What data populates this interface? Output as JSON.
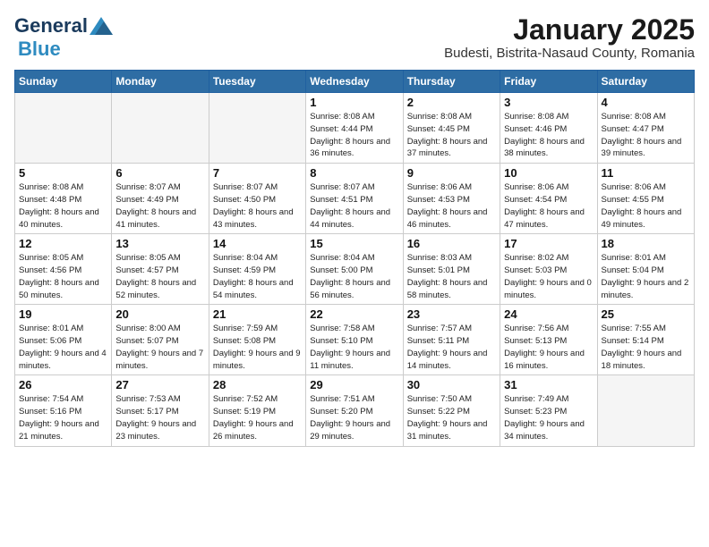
{
  "header": {
    "logo_general": "General",
    "logo_blue": "Blue",
    "month_year": "January 2025",
    "location": "Budesti, Bistrita-Nasaud County, Romania"
  },
  "weekdays": [
    "Sunday",
    "Monday",
    "Tuesday",
    "Wednesday",
    "Thursday",
    "Friday",
    "Saturday"
  ],
  "weeks": [
    [
      {
        "day": "",
        "info": ""
      },
      {
        "day": "",
        "info": ""
      },
      {
        "day": "",
        "info": ""
      },
      {
        "day": "1",
        "info": "Sunrise: 8:08 AM\nSunset: 4:44 PM\nDaylight: 8 hours and 36 minutes."
      },
      {
        "day": "2",
        "info": "Sunrise: 8:08 AM\nSunset: 4:45 PM\nDaylight: 8 hours and 37 minutes."
      },
      {
        "day": "3",
        "info": "Sunrise: 8:08 AM\nSunset: 4:46 PM\nDaylight: 8 hours and 38 minutes."
      },
      {
        "day": "4",
        "info": "Sunrise: 8:08 AM\nSunset: 4:47 PM\nDaylight: 8 hours and 39 minutes."
      }
    ],
    [
      {
        "day": "5",
        "info": "Sunrise: 8:08 AM\nSunset: 4:48 PM\nDaylight: 8 hours and 40 minutes."
      },
      {
        "day": "6",
        "info": "Sunrise: 8:07 AM\nSunset: 4:49 PM\nDaylight: 8 hours and 41 minutes."
      },
      {
        "day": "7",
        "info": "Sunrise: 8:07 AM\nSunset: 4:50 PM\nDaylight: 8 hours and 43 minutes."
      },
      {
        "day": "8",
        "info": "Sunrise: 8:07 AM\nSunset: 4:51 PM\nDaylight: 8 hours and 44 minutes."
      },
      {
        "day": "9",
        "info": "Sunrise: 8:06 AM\nSunset: 4:53 PM\nDaylight: 8 hours and 46 minutes."
      },
      {
        "day": "10",
        "info": "Sunrise: 8:06 AM\nSunset: 4:54 PM\nDaylight: 8 hours and 47 minutes."
      },
      {
        "day": "11",
        "info": "Sunrise: 8:06 AM\nSunset: 4:55 PM\nDaylight: 8 hours and 49 minutes."
      }
    ],
    [
      {
        "day": "12",
        "info": "Sunrise: 8:05 AM\nSunset: 4:56 PM\nDaylight: 8 hours and 50 minutes."
      },
      {
        "day": "13",
        "info": "Sunrise: 8:05 AM\nSunset: 4:57 PM\nDaylight: 8 hours and 52 minutes."
      },
      {
        "day": "14",
        "info": "Sunrise: 8:04 AM\nSunset: 4:59 PM\nDaylight: 8 hours and 54 minutes."
      },
      {
        "day": "15",
        "info": "Sunrise: 8:04 AM\nSunset: 5:00 PM\nDaylight: 8 hours and 56 minutes."
      },
      {
        "day": "16",
        "info": "Sunrise: 8:03 AM\nSunset: 5:01 PM\nDaylight: 8 hours and 58 minutes."
      },
      {
        "day": "17",
        "info": "Sunrise: 8:02 AM\nSunset: 5:03 PM\nDaylight: 9 hours and 0 minutes."
      },
      {
        "day": "18",
        "info": "Sunrise: 8:01 AM\nSunset: 5:04 PM\nDaylight: 9 hours and 2 minutes."
      }
    ],
    [
      {
        "day": "19",
        "info": "Sunrise: 8:01 AM\nSunset: 5:06 PM\nDaylight: 9 hours and 4 minutes."
      },
      {
        "day": "20",
        "info": "Sunrise: 8:00 AM\nSunset: 5:07 PM\nDaylight: 9 hours and 7 minutes."
      },
      {
        "day": "21",
        "info": "Sunrise: 7:59 AM\nSunset: 5:08 PM\nDaylight: 9 hours and 9 minutes."
      },
      {
        "day": "22",
        "info": "Sunrise: 7:58 AM\nSunset: 5:10 PM\nDaylight: 9 hours and 11 minutes."
      },
      {
        "day": "23",
        "info": "Sunrise: 7:57 AM\nSunset: 5:11 PM\nDaylight: 9 hours and 14 minutes."
      },
      {
        "day": "24",
        "info": "Sunrise: 7:56 AM\nSunset: 5:13 PM\nDaylight: 9 hours and 16 minutes."
      },
      {
        "day": "25",
        "info": "Sunrise: 7:55 AM\nSunset: 5:14 PM\nDaylight: 9 hours and 18 minutes."
      }
    ],
    [
      {
        "day": "26",
        "info": "Sunrise: 7:54 AM\nSunset: 5:16 PM\nDaylight: 9 hours and 21 minutes."
      },
      {
        "day": "27",
        "info": "Sunrise: 7:53 AM\nSunset: 5:17 PM\nDaylight: 9 hours and 23 minutes."
      },
      {
        "day": "28",
        "info": "Sunrise: 7:52 AM\nSunset: 5:19 PM\nDaylight: 9 hours and 26 minutes."
      },
      {
        "day": "29",
        "info": "Sunrise: 7:51 AM\nSunset: 5:20 PM\nDaylight: 9 hours and 29 minutes."
      },
      {
        "day": "30",
        "info": "Sunrise: 7:50 AM\nSunset: 5:22 PM\nDaylight: 9 hours and 31 minutes."
      },
      {
        "day": "31",
        "info": "Sunrise: 7:49 AM\nSunset: 5:23 PM\nDaylight: 9 hours and 34 minutes."
      },
      {
        "day": "",
        "info": ""
      }
    ]
  ]
}
